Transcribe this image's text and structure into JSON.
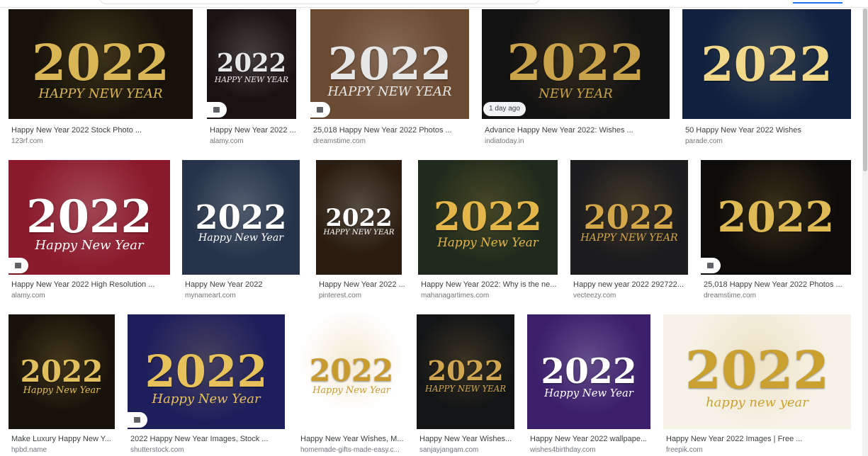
{
  "results": [
    {
      "title": "Happy New Year 2022 Stock Photo ...",
      "source": "123rf.com",
      "year": "2022",
      "sub": "HAPPY NEW YEAR",
      "bg": "#16120a",
      "accent": "#d9b655",
      "badge": ""
    },
    {
      "title": "Happy New Year 2022 ...",
      "source": "alamy.com",
      "year": "2022",
      "sub": "HAPPY NEW YEAR",
      "bg": "#1a1212",
      "accent": "#e8e8e8",
      "badge": "image"
    },
    {
      "title": "25,018 Happy New Year 2022 Photos ...",
      "source": "dreamstime.com",
      "year": "2022",
      "sub": "HAPPY NEW YEAR",
      "bg": "#6b4a32",
      "accent": "#e6e6e6",
      "badge": "image"
    },
    {
      "title": "Advance Happy New Year 2022: Wishes ...",
      "source": "indiatoday.in",
      "year": "2022",
      "sub": "NEW YEAR",
      "bg": "#121212",
      "accent": "#c9a24a",
      "badge": "age",
      "age_label": "1 day ago"
    },
    {
      "title": "50 Happy New Year 2022 Wishes",
      "source": "parade.com",
      "year": "2022",
      "sub": "",
      "bg": "#10213f",
      "accent": "#f2d98a",
      "badge": ""
    },
    {
      "title": "Happy New Year 2022 High Resolution ...",
      "source": "alamy.com",
      "year": "2022",
      "sub": "Happy New Year",
      "bg": "#8a1a2c",
      "accent": "#ffffff",
      "badge": "image"
    },
    {
      "title": "Happy New Year 2022",
      "source": "mynameart.com",
      "year": "2022",
      "sub": "Happy New Year",
      "bg": "#26334a",
      "accent": "#ffffff",
      "badge": ""
    },
    {
      "title": "Happy New Year 2022 ...",
      "source": "pinterest.com",
      "year": "2022",
      "sub": "HAPPY NEW YEAR",
      "bg": "#2a1c10",
      "accent": "#ffffff",
      "badge": ""
    },
    {
      "title": "Happy New Year 2022: Why is the ne...",
      "source": "mahanagartimes.com",
      "year": "2022",
      "sub": "Happy New Year",
      "bg": "#1f2a1c",
      "accent": "#e4b64a",
      "badge": ""
    },
    {
      "title": "Happy new year 2022 292722...",
      "source": "vecteezy.com",
      "year": "2022",
      "sub": "HAPPY NEW YEAR",
      "bg": "#1c1c1e",
      "accent": "#d4a64a",
      "badge": ""
    },
    {
      "title": "25,018 Happy New Year 2022 Photos ...",
      "source": "dreamstime.com",
      "year": "2022",
      "sub": "",
      "bg": "#0e0c0a",
      "accent": "#e0bb55",
      "badge": "image"
    },
    {
      "title": "Make Luxury Happy New Y...",
      "source": "hpbd.name",
      "year": "2022",
      "sub": "Happy New Year",
      "bg": "#17120a",
      "accent": "#e2bf5e",
      "badge": ""
    },
    {
      "title": "2022 Happy New Year Images, Stock ...",
      "source": "shutterstock.com",
      "year": "2022",
      "sub": "Happy New Year",
      "bg": "#1d1f5c",
      "accent": "#e7c25a",
      "badge": "image"
    },
    {
      "title": "Happy New Year Wishes, M...",
      "source": "homemade-gifts-made-easy.c...",
      "year": "2022",
      "sub": "Happy New Year",
      "bg": "#ffffff",
      "accent": "#c99a2e",
      "badge": ""
    },
    {
      "title": "Happy New Year Wishes...",
      "source": "sanjayjangam.com",
      "year": "2022",
      "sub": "HAPPY NEW YEAR",
      "bg": "#121416",
      "accent": "#d1a650",
      "badge": ""
    },
    {
      "title": "Happy New Year 2022 wallpape...",
      "source": "wishes4birthday.com",
      "year": "2022",
      "sub": "Happy New Year",
      "bg": "#3b1f6b",
      "accent": "#ffffff",
      "badge": ""
    },
    {
      "title": "Happy New Year 2022 Images | Free ...",
      "source": "freepik.com",
      "year": "2022",
      "sub": "happy new year",
      "bg": "#f6f2e8",
      "accent": "#caa12f",
      "badge": ""
    }
  ]
}
